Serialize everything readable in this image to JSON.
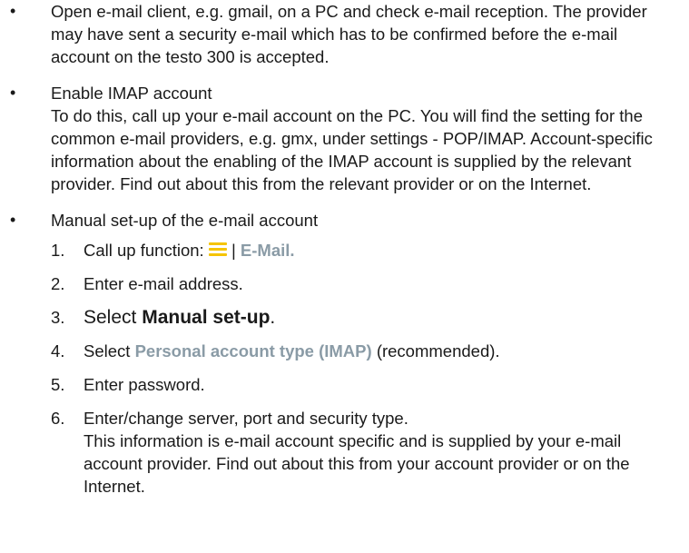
{
  "bullets": [
    {
      "text": "Open e-mail client, e.g. gmail, on a PC and check e-mail reception. The provider may have sent a security e-mail which has to be confirmed before the e-mail account on the testo 300 is accepted."
    },
    {
      "heading": "Enable IMAP account",
      "text": "To do this, call up your e-mail account on the PC. You will find the setting for the common e-mail providers, e.g. gmx, under settings - POP/IMAP. Account-specific information about the enabling of the IMAP account is supplied by the relevant provider. Find out about this from the relevant provider or on the Internet."
    },
    {
      "heading": "Manual set-up of the e-mail account"
    }
  ],
  "steps": {
    "s1": {
      "num": "1.",
      "prefix": "Call up function:",
      "icon": "menu-icon",
      "separator": "|",
      "ui": "E-Mail."
    },
    "s2": {
      "num": "2.",
      "text": "Enter e-mail address."
    },
    "s3": {
      "num": "3.",
      "prefix": "Select",
      "strong": "Manual set-up",
      "suffix": "."
    },
    "s4": {
      "num": "4.",
      "prefix": "Select",
      "ui": "Personal account type (IMAP)",
      "suffix": "(recommended)."
    },
    "s5": {
      "num": "5.",
      "text": "Enter password."
    },
    "s6": {
      "num": "6.",
      "text": "Enter/change server, port and security type.",
      "note": "This information is e-mail account specific and is supplied by your e-mail account provider. Find out about this from your account provider or on the Internet."
    }
  },
  "colors": {
    "ui_reference": "#8a9ba6",
    "menu_icon": "#f5c400",
    "text": "#1a1a1a"
  }
}
